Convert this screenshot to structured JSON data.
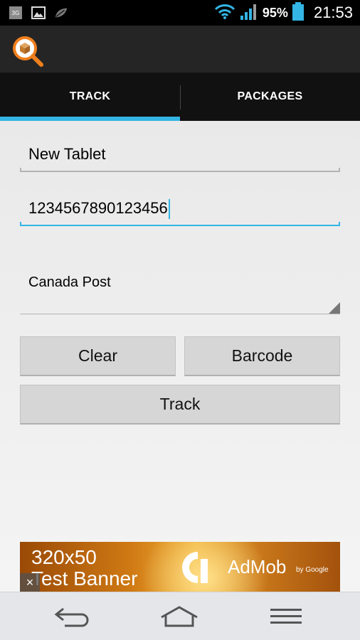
{
  "status_bar": {
    "network_label": "3G",
    "battery_percent": "95%",
    "time": "21:53"
  },
  "tabs": [
    {
      "label": "TRACK",
      "selected": true
    },
    {
      "label": "PACKAGES",
      "selected": false
    }
  ],
  "form": {
    "name_value": "New Tablet",
    "tracking_value": "1234567890123456",
    "carrier_selected": "Canada Post"
  },
  "buttons": {
    "clear_label": "Clear",
    "barcode_label": "Barcode",
    "track_label": "Track"
  },
  "ad": {
    "line1": "320x50",
    "line2": "Test Banner",
    "brand": "AdMob",
    "by": "by Google",
    "close": "×"
  },
  "colors": {
    "accent": "#33b5e5",
    "app_icon": "#f07f1d"
  }
}
